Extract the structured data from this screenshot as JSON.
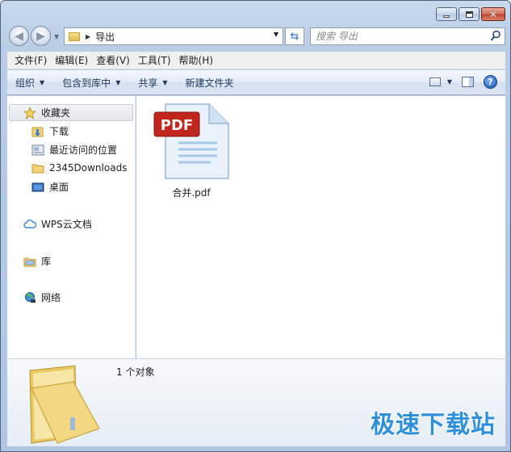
{
  "window": {
    "caption_buttons": {
      "minimize": "minimize",
      "maximize": "maximize",
      "close": "close"
    }
  },
  "address_bar": {
    "path": "导出",
    "search_placeholder": "搜索 导出"
  },
  "menu": {
    "items": [
      "文件(F)",
      "编辑(E)",
      "查看(V)",
      "工具(T)",
      "帮助(H)"
    ]
  },
  "toolbar": {
    "organize": "组织",
    "include_in_library": "包含到库中",
    "share": "共享",
    "new_folder": "新建文件夹"
  },
  "sidebar": {
    "favorites": "收藏夹",
    "favorites_items": [
      "下载",
      "最近访问的位置",
      "2345Downloads",
      "桌面"
    ],
    "wps_cloud": "WPS云文档",
    "libraries": "库",
    "network": "网络"
  },
  "files": [
    {
      "name": "合并.pdf",
      "badge": "PDF"
    }
  ],
  "details": {
    "count_text": "1 个对象"
  },
  "watermark": "极速下载站",
  "colors": {
    "pdf_badge": "#c0261c",
    "accent": "#2f8fd8"
  }
}
